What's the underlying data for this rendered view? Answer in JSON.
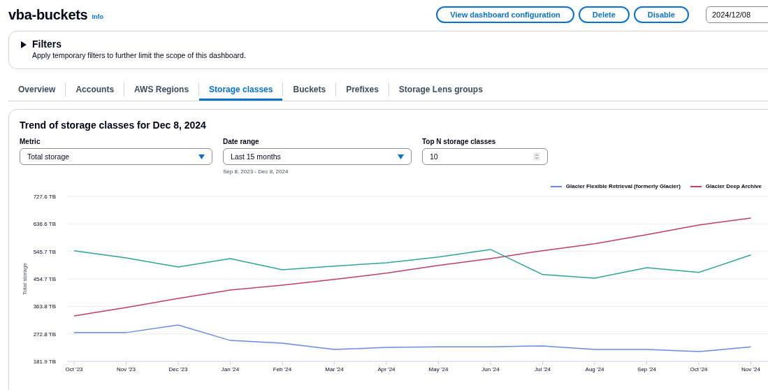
{
  "header": {
    "title": "vba-buckets",
    "info_link": "Info",
    "buttons": [
      "View dashboard configuration",
      "Delete",
      "Disable"
    ],
    "date_field": {
      "value": "2024/12/08"
    }
  },
  "filters": {
    "title": "Filters",
    "expanded": false,
    "description": "Apply temporary filters to further limit the scope of this dashboard."
  },
  "tabs": [
    {
      "label": "Overview",
      "selected": false
    },
    {
      "label": "Accounts",
      "selected": false
    },
    {
      "label": "AWS Regions",
      "selected": false
    },
    {
      "label": "Storage classes",
      "selected": true
    },
    {
      "label": "Buckets",
      "selected": false
    },
    {
      "label": "Prefixes",
      "selected": false
    },
    {
      "label": "Storage Lens groups",
      "selected": false
    }
  ],
  "panel": {
    "title": "Trend of storage classes for Dec 8, 2024",
    "controls": [
      {
        "kind": "select",
        "label": "Metric",
        "value": "Total storage"
      },
      {
        "kind": "select",
        "label": "Date range",
        "value": "Last 15 months",
        "hint": "Sep 8, 2023 - Dec 8, 2024"
      },
      {
        "kind": "number",
        "label": "Top N storage classes",
        "value": "10"
      }
    ],
    "chart_data": {
      "type": "line",
      "ylabel": "Total storage",
      "categories": [
        "Oct '23",
        "Nov '23",
        "Dec '23",
        "Jan '24",
        "Feb '24",
        "Mar '24",
        "Apr '24",
        "May '24",
        "Jun '24",
        "Jul '24",
        "Aug '24",
        "Sep '24",
        "Oct '24",
        "Nov '24"
      ],
      "yticks": [
        {
          "value": 181.9,
          "label": "181.9 TB"
        },
        {
          "value": 272.8,
          "label": "272.8 TB"
        },
        {
          "value": 363.8,
          "label": "363.8 TB"
        },
        {
          "value": 454.7,
          "label": "454.7 TB"
        },
        {
          "value": 545.7,
          "label": "545.7 TB"
        },
        {
          "value": 636.6,
          "label": "636.6 TB"
        },
        {
          "value": 727.6,
          "label": "727.6 TB"
        }
      ],
      "ylim": [
        181.9,
        727.6
      ],
      "grid": true,
      "series": [
        {
          "name": "Glacier Flexible Retrieval (formerly Glacier)",
          "color": "#688ae8",
          "values": [
            277,
            277,
            302,
            251,
            242,
            221,
            228,
            230,
            230,
            233,
            221,
            221,
            214,
            230
          ]
        },
        {
          "name": "Glacier Deep Archive",
          "color": "#c33d69",
          "values": [
            332,
            360,
            390,
            418,
            434,
            453,
            474,
            499,
            522,
            548,
            571,
            601,
            633,
            656
          ]
        },
        {
          "color": "#2ea597",
          "values": [
            548,
            524,
            494,
            522,
            485,
            497,
            508,
            527,
            552,
            469,
            457,
            492,
            476,
            534
          ]
        }
      ]
    }
  }
}
